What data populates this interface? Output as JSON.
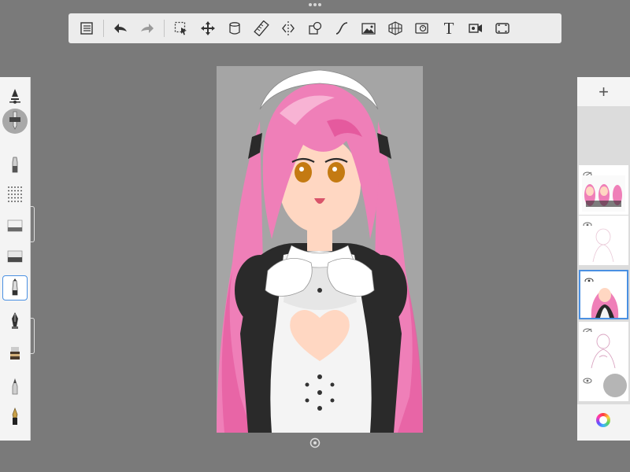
{
  "app": {
    "name": "",
    "accent_color": "#4a90e2",
    "background_color": "#7a7a7a"
  },
  "toolbar": {
    "tools": [
      {
        "name": "layers-list-icon"
      },
      {
        "name": "undo-icon"
      },
      {
        "name": "redo-icon"
      },
      {
        "name": "selection-icon"
      },
      {
        "name": "move-icon"
      },
      {
        "name": "fill-bucket-icon"
      },
      {
        "name": "ruler-icon"
      },
      {
        "name": "symmetry-icon"
      },
      {
        "name": "shapes-icon"
      },
      {
        "name": "curve-icon"
      },
      {
        "name": "image-import-icon"
      },
      {
        "name": "perspective-grid-icon"
      },
      {
        "name": "timelapse-icon"
      },
      {
        "name": "text-tool-icon",
        "label": "T"
      },
      {
        "name": "video-record-icon"
      },
      {
        "name": "fullscreen-icon"
      }
    ]
  },
  "brushes": {
    "active_index": 7,
    "items": [
      {
        "name": "airbrush-icon"
      },
      {
        "name": "pencil-icon"
      },
      {
        "name": "marker-icon"
      },
      {
        "name": "stipple-icon"
      },
      {
        "name": "eraser-soft-icon"
      },
      {
        "name": "eraser-hard-icon"
      },
      {
        "name": "ballpoint-pen-icon"
      },
      {
        "name": "ink-pen-icon"
      },
      {
        "name": "flat-brush-icon"
      },
      {
        "name": "chisel-marker-icon"
      },
      {
        "name": "fountain-pen-icon"
      }
    ]
  },
  "layers": {
    "add_label": "+",
    "active_index": 2,
    "items": [
      {
        "name": "layer-reference-sheet",
        "visible": false
      },
      {
        "name": "layer-sketch",
        "visible": true
      },
      {
        "name": "layer-color",
        "visible": true
      },
      {
        "name": "layer-lineart",
        "visible": false
      },
      {
        "name": "layer-background",
        "visible": true
      }
    ]
  },
  "colors": {
    "current_color": "#b5b5b5",
    "hair": "#ef7fb8",
    "hair_shade": "#e55a9e",
    "skin": "#ffd7c2",
    "eyes": "#c47a12",
    "dress": "#2a2a2a",
    "apron": "#ffffff",
    "canvas_bg": "#a5a5a5"
  }
}
